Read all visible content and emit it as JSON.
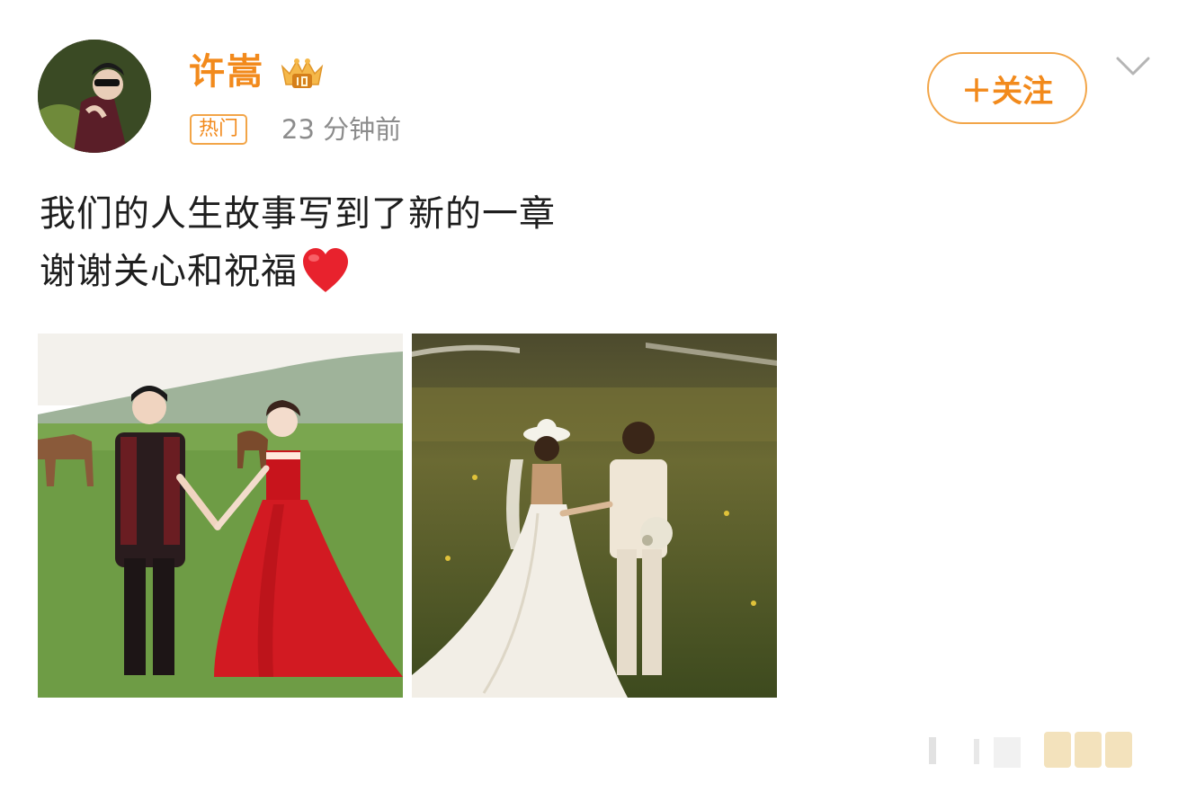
{
  "post": {
    "author": "许嵩",
    "author_badge_icon": "vip-crown-icon",
    "hot_tag": "热门",
    "timestamp": "23 分钟前",
    "follow_label": "＋关注",
    "text_lines": [
      "我们的人生故事写到了新的一章",
      "谢谢关心和祝福"
    ],
    "emoji": "red-heart-icon",
    "images": [
      {
        "subject": "couple-in-black-suit-and-red-gown-on-grassland"
      },
      {
        "subject": "couple-in-white-wedding-attire-at-sunset"
      }
    ]
  },
  "colors": {
    "accent": "#f28a1c",
    "border_accent": "#f2a548",
    "secondary_text": "#8c8c8c"
  }
}
